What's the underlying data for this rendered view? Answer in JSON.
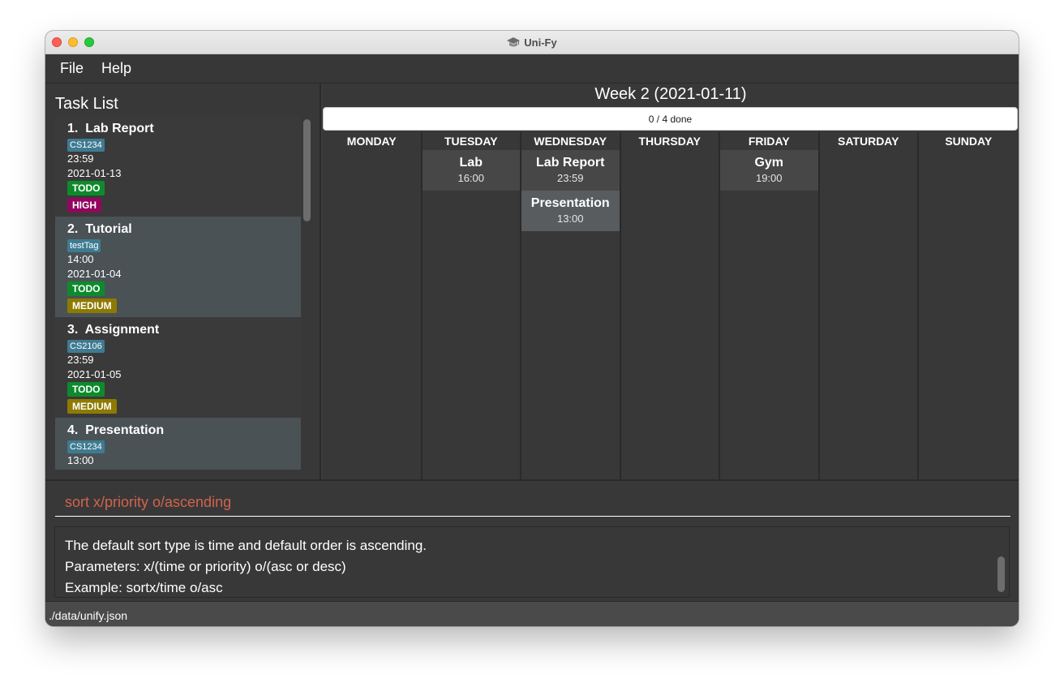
{
  "window": {
    "title": "Uni-Fy",
    "icon": "graduation-cap-icon"
  },
  "menu": {
    "items": [
      "File",
      "Help"
    ]
  },
  "task_panel": {
    "title": "Task List",
    "tasks": [
      {
        "index": "1.",
        "name": "Lab Report",
        "tag": "CS1234",
        "time": "23:59",
        "date": "2021-01-13",
        "status": "TODO",
        "priority": "HIGH"
      },
      {
        "index": "2.",
        "name": "Tutorial",
        "tag": "testTag",
        "time": "14:00",
        "date": "2021-01-04",
        "status": "TODO",
        "priority": "MEDIUM"
      },
      {
        "index": "3.",
        "name": "Assignment",
        "tag": "CS2106",
        "time": "23:59",
        "date": "2021-01-05",
        "status": "TODO",
        "priority": "MEDIUM"
      },
      {
        "index": "4.",
        "name": "Presentation",
        "tag": "CS1234",
        "time": "13:00"
      }
    ]
  },
  "calendar": {
    "week_label": "Week 2 (2021-01-11)",
    "progress_text": "0 / 4 done",
    "progress_value": 0,
    "days": [
      {
        "name": "MONDAY",
        "events": []
      },
      {
        "name": "TUESDAY",
        "events": [
          {
            "title": "Lab",
            "time": "16:00"
          }
        ]
      },
      {
        "name": "WEDNESDAY",
        "events": [
          {
            "title": "Lab Report",
            "time": "23:59"
          },
          {
            "title": "Presentation",
            "time": "13:00"
          }
        ]
      },
      {
        "name": "THURSDAY",
        "events": []
      },
      {
        "name": "FRIDAY",
        "events": [
          {
            "title": "Gym",
            "time": "19:00"
          }
        ]
      },
      {
        "name": "SATURDAY",
        "events": []
      },
      {
        "name": "SUNDAY",
        "events": []
      }
    ]
  },
  "command": {
    "value": "sort x/priority o/ascending"
  },
  "result": {
    "lines": [
      "The default sort type is time and default order is ascending.",
      "Parameters: x/(time or priority) o/(asc or desc)",
      "Example: sortx/time o/asc"
    ]
  },
  "status": {
    "path": "./data/unify.json"
  },
  "colors": {
    "background": "#383838",
    "tag": "#3e7b91",
    "todo": "#0d8b2c",
    "high": "#91075f",
    "medium": "#8e7a00",
    "command_text": "#d4624c"
  }
}
